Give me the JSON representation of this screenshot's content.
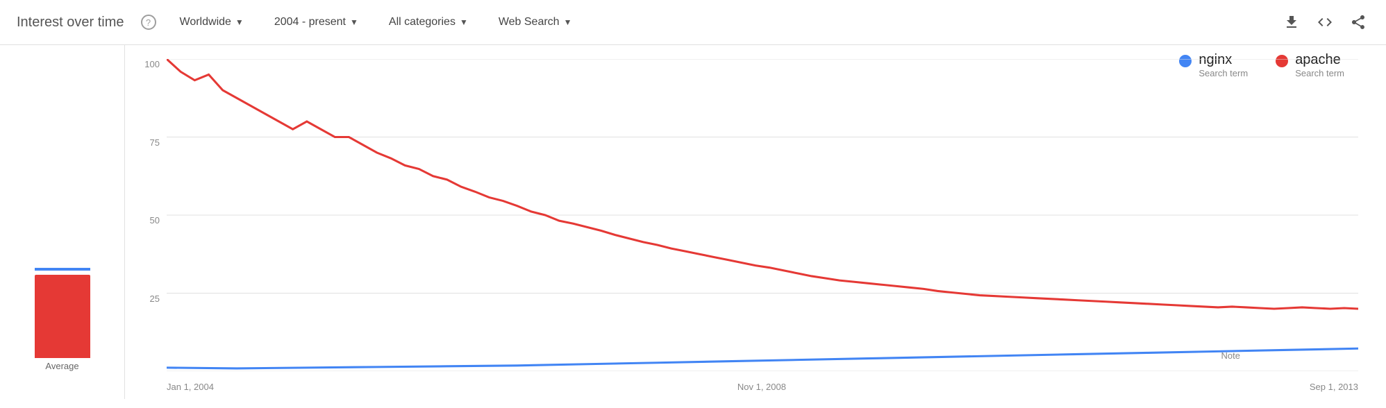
{
  "header": {
    "title": "Interest over time",
    "help_icon": "?",
    "filters": [
      {
        "id": "region",
        "label": "Worldwide"
      },
      {
        "id": "time",
        "label": "2004 - present"
      },
      {
        "id": "category",
        "label": "All categories"
      },
      {
        "id": "search_type",
        "label": "Web Search"
      }
    ],
    "actions": [
      {
        "id": "download",
        "icon": "⬇"
      },
      {
        "id": "embed",
        "icon": "<>"
      },
      {
        "id": "share",
        "icon": "↗"
      }
    ]
  },
  "legend": [
    {
      "id": "nginx",
      "name": "nginx",
      "sub": "Search term",
      "color": "#4285f4"
    },
    {
      "id": "apache",
      "name": "apache",
      "sub": "Search term",
      "color": "#e53935"
    }
  ],
  "y_axis": {
    "labels": [
      "100",
      "75",
      "50",
      "25",
      ""
    ]
  },
  "x_axis": {
    "labels": [
      "Jan 1, 2004",
      "Nov 1, 2008",
      "Sep 1, 2013"
    ]
  },
  "sidebar": {
    "label": "Average",
    "bar_color": "#e53935",
    "line_color": "#4285f4"
  },
  "note": {
    "label": "Note"
  },
  "colors": {
    "apache": "#e53935",
    "nginx": "#4285f4",
    "grid": "#e0e0e0"
  }
}
